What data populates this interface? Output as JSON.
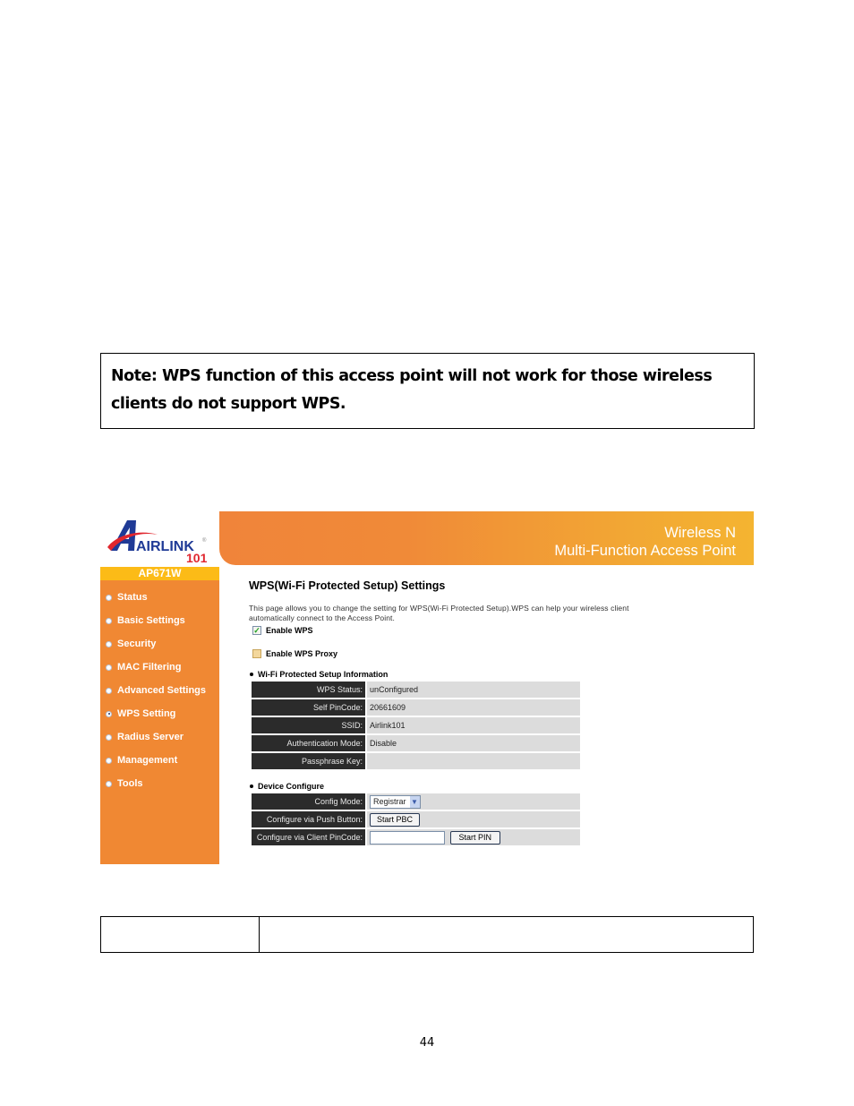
{
  "note": {
    "line1": "Note: WPS function of this access point will not work for those wireless",
    "line2": "clients do not support WPS."
  },
  "router_ui": {
    "brand": {
      "logo_text": "AIRLINK",
      "logo_number": "101",
      "registered_mark": "®",
      "model": "AP671W"
    },
    "header": {
      "line1": "Wireless N",
      "line2": "Multi-Function Access Point",
      "gradient_start": "#f0843a",
      "gradient_end": "#f4b431"
    },
    "sidebar": {
      "background": "#f08833",
      "items": [
        {
          "label": "Status",
          "selected": false
        },
        {
          "label": "Basic Settings",
          "selected": false
        },
        {
          "label": "Security",
          "selected": false
        },
        {
          "label": "MAC Filtering",
          "selected": false
        },
        {
          "label": "Advanced Settings",
          "selected": false
        },
        {
          "label": "WPS Setting",
          "selected": true
        },
        {
          "label": "Radius Server",
          "selected": false
        },
        {
          "label": "Management",
          "selected": false
        },
        {
          "label": "Tools",
          "selected": false
        }
      ]
    },
    "main": {
      "title": "WPS(Wi-Fi Protected Setup) Settings",
      "description": "This page allows you to change the setting for WPS(Wi-Fi Protected Setup).WPS can help your wireless client automatically connect to the Access Point.",
      "enable_wps": {
        "label": "Enable WPS",
        "checked": true
      },
      "enable_wps_proxy": {
        "label": "Enable WPS Proxy",
        "checked": false
      },
      "info_section": {
        "title": "Wi-Fi Protected Setup Information",
        "rows": [
          {
            "label": "WPS Status:",
            "value": "unConfigured"
          },
          {
            "label": "Self PinCode:",
            "value": "20661609"
          },
          {
            "label": "SSID:",
            "value": "Airlink101"
          },
          {
            "label": "Authentication Mode:",
            "value": "Disable"
          },
          {
            "label": "Passphrase Key:",
            "value": ""
          }
        ]
      },
      "device_section": {
        "title": "Device Configure",
        "config_mode": {
          "label": "Config Mode:",
          "value": "Registrar"
        },
        "push_button": {
          "label": "Configure via Push Button:",
          "button": "Start PBC"
        },
        "client_pin": {
          "label": "Configure via Client PinCode:",
          "value": "",
          "button": "Start PIN"
        }
      }
    }
  },
  "bottom_table": {
    "cells": [
      "",
      ""
    ]
  },
  "page_number": "44"
}
